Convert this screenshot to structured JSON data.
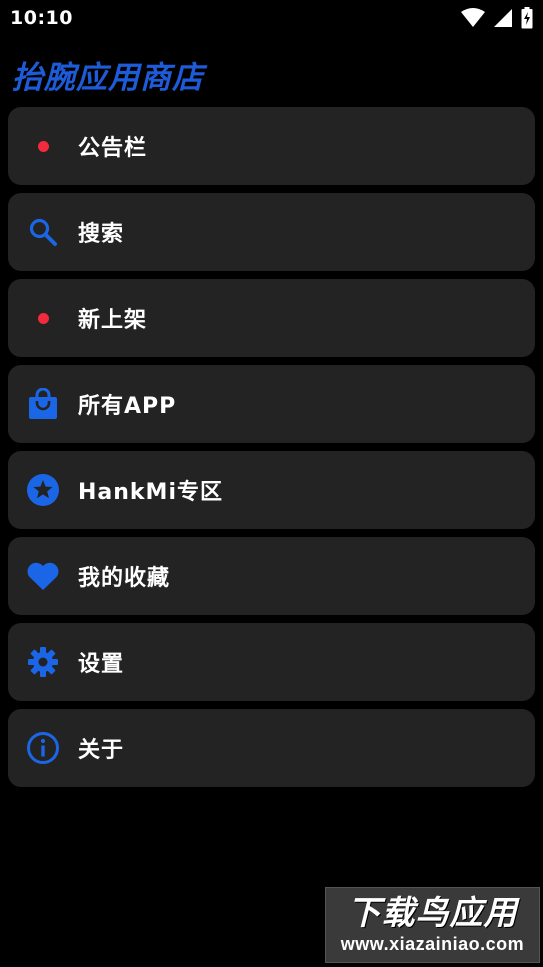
{
  "status_bar": {
    "time": "10:10",
    "icons": [
      "wifi-icon",
      "cell-signal-icon",
      "battery-charging-icon"
    ]
  },
  "app": {
    "title": "抬腕应用商店"
  },
  "menu": {
    "items": [
      {
        "id": "bulletin",
        "label": "公告栏",
        "icon": "red-dot-icon"
      },
      {
        "id": "search",
        "label": "搜索",
        "icon": "search-icon"
      },
      {
        "id": "new",
        "label": "新上架",
        "icon": "red-dot-icon"
      },
      {
        "id": "all-apps",
        "label": "所有APP",
        "icon": "shopping-bag-icon"
      },
      {
        "id": "hankmi",
        "label": "HankMi专区",
        "icon": "star-circle-icon"
      },
      {
        "id": "favorites",
        "label": "我的收藏",
        "icon": "heart-icon"
      },
      {
        "id": "settings",
        "label": "设置",
        "icon": "gear-icon"
      },
      {
        "id": "about",
        "label": "关于",
        "icon": "info-icon"
      }
    ]
  },
  "watermark": {
    "brand": "下载鸟应用",
    "url": "www.xiazainiao.com"
  },
  "colors": {
    "background": "#000000",
    "card": "#232323",
    "accent": "#1a66e6",
    "title": "#1e5bd8",
    "dot": "#f22a3e",
    "text": "#ffffff"
  }
}
